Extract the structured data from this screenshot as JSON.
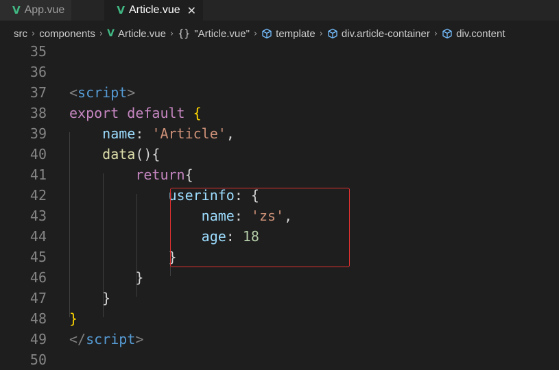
{
  "tabs": [
    {
      "label": "App.vue",
      "active": false,
      "icon": "vue-icon"
    },
    {
      "label": "Article.vue",
      "active": true,
      "icon": "vue-icon",
      "close": "✕"
    }
  ],
  "breadcrumb": {
    "items": [
      "src",
      "components",
      "Article.vue",
      "\"Article.vue\"",
      "template",
      "div.article-container",
      "div.content"
    ],
    "separator": "›"
  },
  "editor": {
    "line_numbers": [
      "35",
      "36",
      "37",
      "38",
      "39",
      "40",
      "41",
      "42",
      "43",
      "44",
      "45",
      "46",
      "47",
      "48",
      "49",
      "50"
    ],
    "lines": [
      {
        "tokens": []
      },
      {
        "tokens": []
      },
      {
        "tokens": [
          [
            "tok-punct-tag",
            "<"
          ],
          [
            "tok-tag",
            "script"
          ],
          [
            "tok-punct-tag",
            ">"
          ]
        ]
      },
      {
        "tokens": [
          [
            "tok-kw",
            "export"
          ],
          [
            "tok-plain",
            " "
          ],
          [
            "tok-kw",
            "default"
          ],
          [
            "tok-plain",
            " "
          ],
          [
            "tok-brace",
            "{"
          ]
        ]
      },
      {
        "tokens": [
          [
            "tok-plain",
            "    "
          ],
          [
            "tok-prop",
            "name"
          ],
          [
            "tok-plain",
            ": "
          ],
          [
            "tok-str",
            "'Article'"
          ],
          [
            "tok-plain",
            ","
          ]
        ]
      },
      {
        "tokens": [
          [
            "tok-plain",
            "    "
          ],
          [
            "tok-fn",
            "data"
          ],
          [
            "tok-plain",
            "(){"
          ]
        ]
      },
      {
        "tokens": [
          [
            "tok-plain",
            "        "
          ],
          [
            "tok-kw",
            "return"
          ],
          [
            "tok-plain",
            "{"
          ]
        ]
      },
      {
        "tokens": [
          [
            "tok-plain",
            "            "
          ],
          [
            "tok-prop",
            "userinfo"
          ],
          [
            "tok-plain",
            ": {"
          ]
        ]
      },
      {
        "tokens": [
          [
            "tok-plain",
            "                "
          ],
          [
            "tok-prop",
            "name"
          ],
          [
            "tok-plain",
            ": "
          ],
          [
            "tok-str",
            "'zs'"
          ],
          [
            "tok-plain",
            ","
          ]
        ]
      },
      {
        "tokens": [
          [
            "tok-plain",
            "                "
          ],
          [
            "tok-prop",
            "age"
          ],
          [
            "tok-plain",
            ": "
          ],
          [
            "tok-num",
            "18"
          ]
        ]
      },
      {
        "tokens": [
          [
            "tok-plain",
            "            "
          ],
          [
            "tok-plain",
            "}"
          ]
        ]
      },
      {
        "tokens": [
          [
            "tok-plain",
            "        "
          ],
          [
            "tok-plain",
            "}"
          ]
        ]
      },
      {
        "tokens": [
          [
            "tok-plain",
            "    "
          ],
          [
            "tok-plain",
            "}"
          ]
        ]
      },
      {
        "tokens": [
          [
            "tok-brace",
            "}"
          ]
        ]
      },
      {
        "tokens": [
          [
            "tok-punct-tag",
            "</"
          ],
          [
            "tok-tag",
            "script"
          ],
          [
            "tok-punct-tag",
            ">"
          ]
        ]
      },
      {
        "tokens": []
      }
    ],
    "highlight_color": "#e03030"
  },
  "colors": {
    "vue_green": "#41b883",
    "editor_bg": "#1e1e1e",
    "tab_bg": "#252526"
  }
}
